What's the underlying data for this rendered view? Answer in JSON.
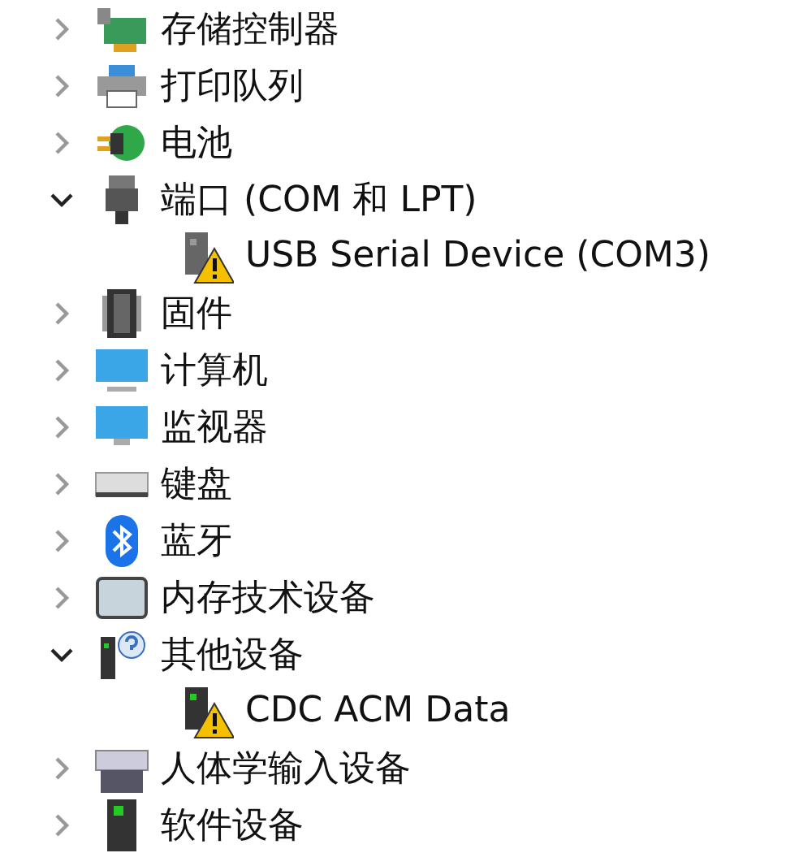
{
  "tree": [
    {
      "label": "存储控制器",
      "expanded": false
    },
    {
      "label": "打印队列",
      "expanded": false
    },
    {
      "label": "电池",
      "expanded": false
    },
    {
      "label": "端口 (COM 和 LPT)",
      "expanded": true,
      "children": [
        {
          "label": "USB Serial Device (COM3)",
          "warning": true
        }
      ]
    },
    {
      "label": "固件",
      "expanded": false
    },
    {
      "label": "计算机",
      "expanded": false
    },
    {
      "label": "监视器",
      "expanded": false
    },
    {
      "label": "键盘",
      "expanded": false
    },
    {
      "label": "蓝牙",
      "expanded": false
    },
    {
      "label": "内存技术设备",
      "expanded": false
    },
    {
      "label": "其他设备",
      "expanded": true,
      "children": [
        {
          "label": "CDC ACM Data",
          "warning": true
        }
      ]
    },
    {
      "label": "人体学输入设备",
      "expanded": false
    },
    {
      "label": "软件设备",
      "expanded": false
    }
  ]
}
